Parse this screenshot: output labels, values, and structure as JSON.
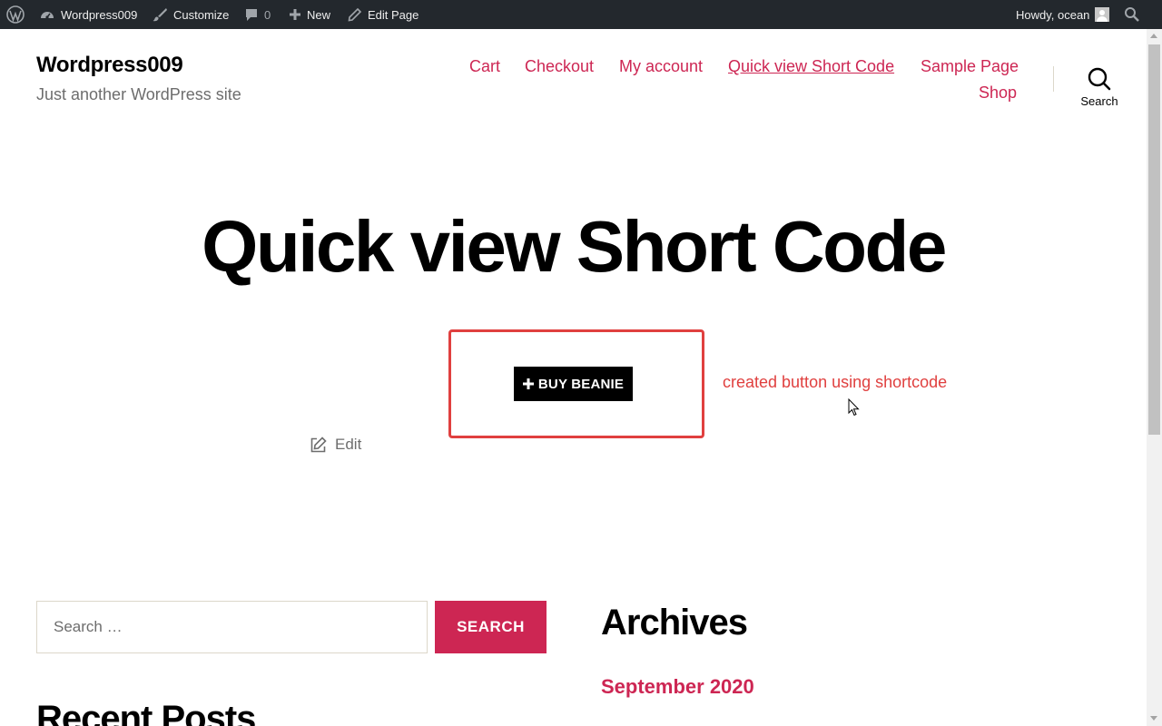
{
  "adminbar": {
    "wp_icon": "wordpress-logo-icon",
    "site_name": "Wordpress009",
    "customize": "Customize",
    "comments_count": "0",
    "new_label": "New",
    "edit_page": "Edit Page",
    "howdy": "Howdy, ocean",
    "search_icon": "search-icon"
  },
  "header": {
    "site_title": "Wordpress009",
    "site_description": "Just another WordPress site",
    "menu": [
      "Cart",
      "Checkout",
      "My account",
      "Quick view Short Code",
      "Sample Page",
      "Shop"
    ],
    "current_menu": "Quick view Short Code",
    "search_label": "Search"
  },
  "content": {
    "page_title": "Quick view Short Code",
    "buy_button": "BUY BEANIE",
    "annotation": "created button using shortcode",
    "edit_label": "Edit"
  },
  "widgets": {
    "search_placeholder": "Search …",
    "search_button": "SEARCH",
    "archives_title": "Archives",
    "archive_item": "September 2020",
    "recent_posts_title": "Recent Posts"
  },
  "colors": {
    "accent": "#cd2653",
    "adminbar_bg": "#23282d",
    "annotation_red": "#e0403f",
    "secondary_text": "#6d6d6d"
  }
}
